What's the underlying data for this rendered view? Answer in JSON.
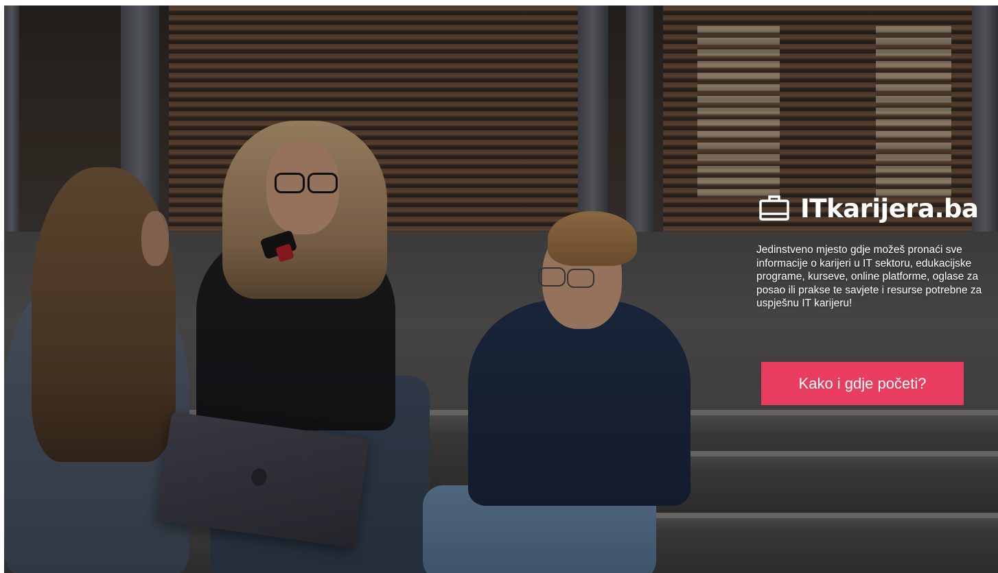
{
  "brand": {
    "name": "ITkarijera.ba",
    "icon": "briefcase-icon",
    "color": "#ffffff"
  },
  "hero": {
    "tagline": "Jedinstveno mjesto gdje možeš pronaći sve informacije o karijeri u IT sektoru, edukacijske programe, kurseve, online platforme, oglase za posao ili prakse te savjete i resurse potrebne za uspješnu IT karijeru!",
    "cta_label": "Kako i gdje početi?",
    "cta_color": "#e83d5f"
  }
}
